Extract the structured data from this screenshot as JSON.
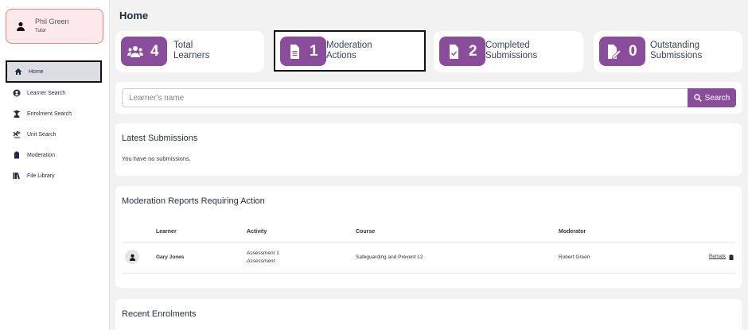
{
  "user": {
    "name": "Phil Green",
    "role": "Tutor",
    "icon": "person-icon"
  },
  "sidebar": {
    "items": [
      {
        "label": "Home",
        "icon": "home-icon",
        "active": true
      },
      {
        "label": "Learner Search",
        "icon": "user-circle-icon"
      },
      {
        "label": "Enrolment Search",
        "icon": "graduate-icon"
      },
      {
        "label": "Unit Search",
        "icon": "unit-search-icon"
      },
      {
        "label": "Moderation",
        "icon": "clipboard-icon"
      },
      {
        "label": "File Library",
        "icon": "library-icon"
      }
    ]
  },
  "page": {
    "title": "Home"
  },
  "stats": [
    {
      "value": "4",
      "label_line1": "Total",
      "label_line2": "Learners",
      "icon": "users-icon"
    },
    {
      "value": "1",
      "label_line1": "Moderation",
      "label_line2": "Actions",
      "icon": "document-icon"
    },
    {
      "value": "2",
      "label_line1": "Completed",
      "label_line2": "Submissions",
      "icon": "document-check-icon"
    },
    {
      "value": "0",
      "label_line1": "Outstanding",
      "label_line2": "Submissions",
      "icon": "document-edit-icon"
    }
  ],
  "search": {
    "placeholder": "Learner's name",
    "button_label": "Search"
  },
  "latest": {
    "title": "Latest Submissions",
    "empty_text": "You have no submissions."
  },
  "moderation": {
    "title": "Moderation Reports Requiring Action",
    "columns": [
      "Learner",
      "Activity",
      "Course",
      "Moderator"
    ],
    "rows": [
      {
        "learner": "Gary Jones",
        "activity": "Assessment 1",
        "activity_type": "Assessment",
        "course": "Safeguarding and Prevent L2",
        "moderator": "Robert Green",
        "action": "Remark"
      }
    ]
  },
  "recent": {
    "title": "Recent Enrolments"
  },
  "colors": {
    "accent": "#8a4d9c",
    "user_card_bg": "#fde9e9",
    "user_card_border": "#e8827f",
    "page_bg": "#f2f2f2"
  }
}
